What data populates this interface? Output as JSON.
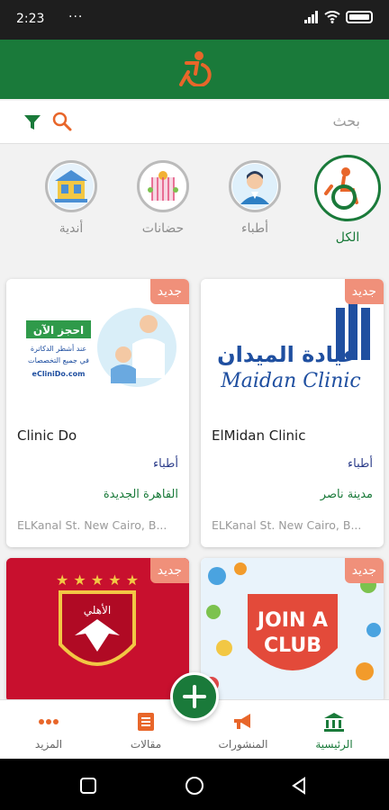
{
  "status_bar": {
    "time": "2:23",
    "dots": "···"
  },
  "search": {
    "placeholder": "بحث"
  },
  "categories": [
    {
      "label": "الكل",
      "icon": "wheelchair-icon",
      "active": true
    },
    {
      "label": "أطباء",
      "icon": "doctor-icon",
      "active": false
    },
    {
      "label": "حضانات",
      "icon": "nursery-icon",
      "active": false
    },
    {
      "label": "أندية",
      "icon": "club-icon",
      "active": false
    }
  ],
  "cards": [
    {
      "badge": "جديد",
      "title": "ElMidan Clinic",
      "category": "أطباء",
      "city": "مدينة ناصر",
      "address": "ELKanal St. New Cairo, B...",
      "logo_arabic": "عيادة الميدان",
      "logo_english": "Maidan Clinic"
    },
    {
      "badge": "جديد",
      "title": "Clinic Do",
      "category": "أطباء",
      "city": "القاهرة الجديدة",
      "address": "ELKanal St. New Cairo, B...",
      "promo_title": "احجز الآن",
      "promo_line1": "عند أشطر الدكاترة",
      "promo_line2": "في جميع التخصصات",
      "promo_site": "eCliniDo.com"
    },
    {
      "badge": "جديد",
      "poster_text1": "JOIN A",
      "poster_text2": "CLUB"
    },
    {
      "badge": "جديد",
      "crest_text": "الأهلي"
    }
  ],
  "bottom_nav": {
    "home": "الرئيسية",
    "posts": "المنشورات",
    "articles": "مقالات",
    "more": "المزيد"
  },
  "colors": {
    "primary": "#1a7a3a",
    "accent": "#e8662a",
    "badge": "#f0907a"
  }
}
